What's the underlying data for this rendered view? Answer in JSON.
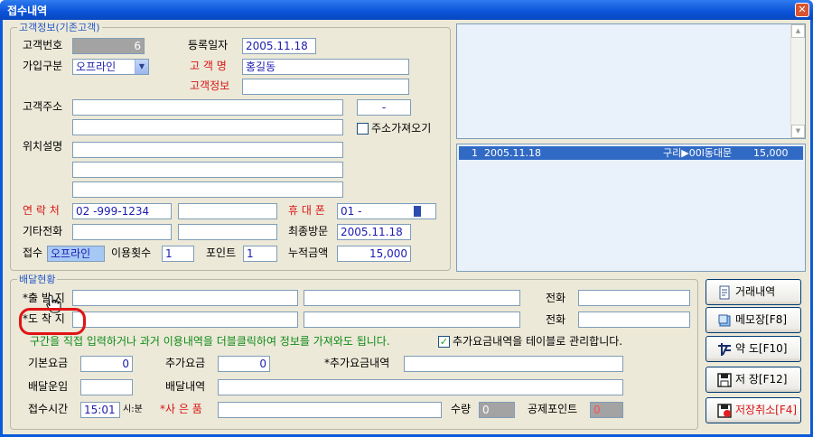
{
  "window": {
    "title": "접수내역",
    "close_symbol": "✕"
  },
  "customer": {
    "legend": "고객정보(기존고객)",
    "customer_no_label": "고객번호",
    "customer_no": "6",
    "register_date_label": "등록일자",
    "register_date": "2005.11.18",
    "join_type_label": "가입구분",
    "join_type": "오프라인",
    "name_label": "고 객 명",
    "name": "홍길동",
    "info_label": "고객정보",
    "info": "",
    "address_label": "고객주소",
    "zip": "-",
    "address1": "",
    "address2": "",
    "address_fetch_label": "주소가져오기",
    "location_label": "위치설명",
    "location1": "",
    "location2": "",
    "location3": "",
    "contact_label": "연 락 처",
    "contact": "02  -999-1234",
    "contact_ext": "",
    "mobile_label": "휴 대 폰",
    "mobile": "01 -",
    "other_phone_label": "기타전화",
    "other_phone1": "",
    "other_phone2": "",
    "last_visit_label": "최종방문",
    "last_visit": "2005.11.18",
    "reception_label": "접수",
    "reception": "오프라인",
    "use_count_label": "이용횟수",
    "use_count": "1",
    "points_label": "포인트",
    "points": "1",
    "total_amount_label": "누적금액",
    "total_amount": "15,000"
  },
  "history": {
    "rows": [
      {
        "no": "1",
        "date": "2005.11.18",
        "route": "구리▶00l동대문",
        "amount": "15,000"
      }
    ]
  },
  "delivery": {
    "legend": "배달현황",
    "departure_label": "*출 발 지",
    "departure1": "",
    "departure2": "",
    "arrival_label": "*도 착 지",
    "arrival1": "",
    "arrival2": "",
    "phone_label": "전화",
    "phone1": "",
    "phone2": "",
    "hint": "구간을 직접 입력하거나 과거 이용내역을 더블클릭하여 정보를 가져와도 됩니다.",
    "extra_table_label": "추가요금내역을 테이블로 관리합니다.",
    "base_fee_label": "기본요금",
    "base_fee": "0",
    "extra_fee_label": "추가요금",
    "extra_fee": "0",
    "extra_detail_label": "*추가요금내역",
    "extra_detail": "",
    "delivery_fee_label": "배달운임",
    "delivery_fee": "",
    "delivery_detail_label": "배달내역",
    "delivery_detail": "",
    "time_label": "접수시간",
    "time": "15:01",
    "time_unit": "시:분",
    "reason_label": "*사 은 품",
    "reason": "",
    "qty_label": "수량",
    "qty": "0",
    "deduct_label": "공제포인트",
    "deduct": "0"
  },
  "buttons": {
    "transactions": "거래내역",
    "memo": "메모장[F8]",
    "map": "약 도[F10]",
    "save": "저 장[F12]",
    "cancel_save": "저장취소[F4]"
  },
  "colors": {
    "title_bar": "#0A5ADB",
    "label_red": "#D81515",
    "hint_green": "#0E8A17",
    "selection": "#316AC5"
  }
}
